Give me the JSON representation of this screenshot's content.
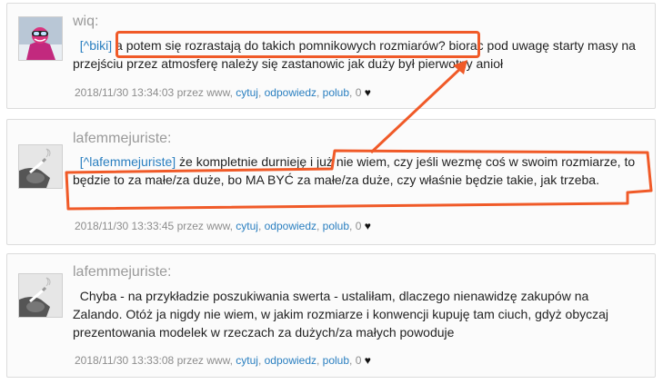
{
  "comments": [
    {
      "author": "wiq:",
      "mention": "[^biki]",
      "body": " a potem się rozrastają do takich pomnikowych rozmiarów? biorac pod uwagę starty masy na przejściu przez atmosferę należy się zastanowic jak duży był pierwotny anioł",
      "timestamp": "2018/11/30 13:34:03",
      "by": "przez www,",
      "actions": {
        "quote": "cytuj",
        "reply": "odpowiedz",
        "like": "polub"
      },
      "likes": "0",
      "heart": "♥"
    },
    {
      "author": "lafemmejuriste:",
      "mention": "[^lafemmejuriste]",
      "body": " że kompletnie durnieję i już nie wiem, czy jeśli wezmę coś w swoim rozmiarze, to będzie to za małe/za duże, bo MA BYĆ za małe/za duże, czy właśnie będzie takie, jak trzeba.",
      "timestamp": "2018/11/30 13:33:45",
      "by": "przez www,",
      "actions": {
        "quote": "cytuj",
        "reply": "odpowiedz",
        "like": "polub"
      },
      "likes": "0",
      "heart": "♥"
    },
    {
      "author": "lafemmejuriste:",
      "mention": "",
      "body": "Chyba - na przykładzie poszukiwania swerta - ustaliłam, dlaczego nienawidzę zakupów na Zalando. Otóż ja nigdy nie wiem, w jakim rozmiarze i konwencji kupuję tam ciuch, gdyż obyczaj prezentowania modelek w rzeczach za dużych/za małych powoduje",
      "timestamp": "2018/11/30 13:33:08",
      "by": "przez www,",
      "actions": {
        "quote": "cytuj",
        "reply": "odpowiedz",
        "like": "polub"
      },
      "likes": "0",
      "heart": "♥"
    }
  ],
  "annotation_color": "#f05a28"
}
